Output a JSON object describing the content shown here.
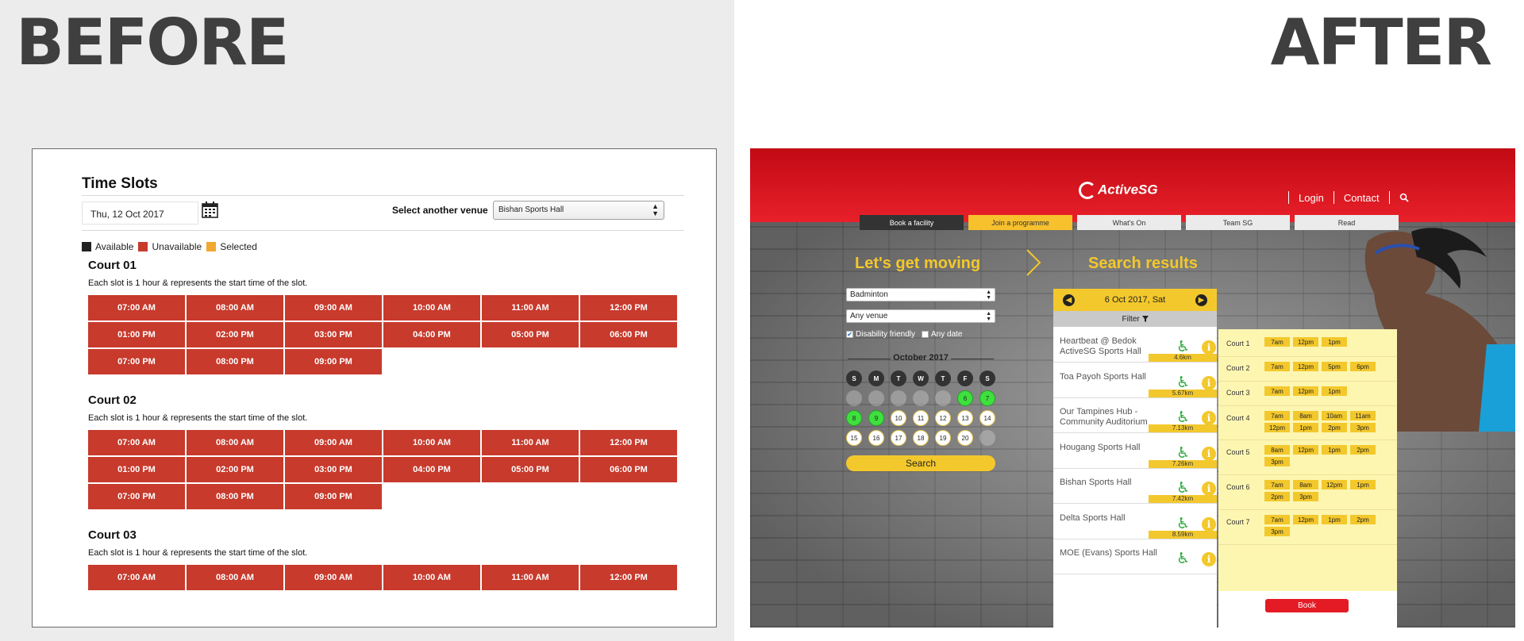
{
  "labels": {
    "before": "BEFORE",
    "after": "AFTER"
  },
  "before": {
    "title": "Time Slots",
    "date_value": "Thu, 12 Oct 2017",
    "venue_label": "Select another venue",
    "venue_value": "Bishan Sports Hall",
    "legend": [
      {
        "label": "Available",
        "color": "#222222"
      },
      {
        "label": "Unavailable",
        "color": "#c73a2c"
      },
      {
        "label": "Selected",
        "color": "#f0a830"
      }
    ],
    "courts": [
      {
        "name": "Court 01",
        "desc": "Each slot is 1 hour & represents the start time of the slot.",
        "slots": [
          "07:00 AM",
          "08:00 AM",
          "09:00 AM",
          "10:00 AM",
          "11:00 AM",
          "12:00 PM",
          "01:00 PM",
          "02:00 PM",
          "03:00 PM",
          "04:00 PM",
          "05:00 PM",
          "06:00 PM",
          "07:00 PM",
          "08:00 PM",
          "09:00 PM"
        ]
      },
      {
        "name": "Court 02",
        "desc": "Each slot is 1 hour & represents the start time of the slot.",
        "slots": [
          "07:00 AM",
          "08:00 AM",
          "09:00 AM",
          "10:00 AM",
          "11:00 AM",
          "12:00 PM",
          "01:00 PM",
          "02:00 PM",
          "03:00 PM",
          "04:00 PM",
          "05:00 PM",
          "06:00 PM",
          "07:00 PM",
          "08:00 PM",
          "09:00 PM"
        ]
      },
      {
        "name": "Court 03",
        "desc": "Each slot is 1 hour & represents the start time of the slot.",
        "slots": [
          "07:00 AM",
          "08:00 AM",
          "09:00 AM",
          "10:00 AM",
          "11:00 AM",
          "12:00 PM"
        ]
      }
    ]
  },
  "after": {
    "logo": "ActiveSG",
    "topnav": [
      "Login",
      "Contact"
    ],
    "tabs": [
      "Book a facility",
      "Join a programme",
      "What's On",
      "Team SG",
      "Read"
    ],
    "hero_left": "Let's get moving",
    "hero_right": "Search results",
    "sport_value": "Badminton",
    "venue_value": "Any venue",
    "check_disability": "Disability friendly",
    "check_anydate": "Any date",
    "month": "October 2017",
    "weekdays": [
      "S",
      "M",
      "T",
      "W",
      "T",
      "F",
      "S"
    ],
    "days": [
      {
        "d": "",
        "s": "past"
      },
      {
        "d": "",
        "s": "past"
      },
      {
        "d": "",
        "s": "past"
      },
      {
        "d": "",
        "s": "past"
      },
      {
        "d": "",
        "s": "past"
      },
      {
        "d": "6",
        "s": "green"
      },
      {
        "d": "7",
        "s": "green"
      },
      {
        "d": "8",
        "s": "green"
      },
      {
        "d": "9",
        "s": "green"
      },
      {
        "d": "10",
        "s": "white"
      },
      {
        "d": "11",
        "s": "white"
      },
      {
        "d": "12",
        "s": "white"
      },
      {
        "d": "13",
        "s": "white"
      },
      {
        "d": "14",
        "s": "white"
      },
      {
        "d": "15",
        "s": "white"
      },
      {
        "d": "16",
        "s": "white"
      },
      {
        "d": "17",
        "s": "white"
      },
      {
        "d": "18",
        "s": "white"
      },
      {
        "d": "19",
        "s": "white"
      },
      {
        "d": "20",
        "s": "white"
      },
      {
        "d": "",
        "s": "past"
      }
    ],
    "search_label": "Search",
    "result_date": "6 Oct 2017, Sat",
    "filter_label": "Filter",
    "venues": [
      {
        "name": "Heartbeat @ Bedok ActiveSG Sports Hall",
        "dist": "4.6km"
      },
      {
        "name": "Toa Payoh Sports Hall",
        "dist": "5.67km"
      },
      {
        "name": "Our Tampines Hub - Community Auditorium",
        "dist": "7.13km"
      },
      {
        "name": "Hougang Sports Hall",
        "dist": "7.26km"
      },
      {
        "name": "Bishan Sports Hall",
        "dist": "7.42km"
      },
      {
        "name": "Delta Sports Hall",
        "dist": "8.59km"
      },
      {
        "name": "MOE (Evans) Sports Hall",
        "dist": ""
      }
    ],
    "courts": [
      {
        "name": "Court 1",
        "times": [
          "7am",
          "12pm",
          "1pm"
        ]
      },
      {
        "name": "Court 2",
        "times": [
          "7am",
          "12pm",
          "5pm",
          "6pm"
        ]
      },
      {
        "name": "Court 3",
        "times": [
          "7am",
          "12pm",
          "1pm"
        ]
      },
      {
        "name": "Court 4",
        "times": [
          "7am",
          "8am",
          "10am",
          "11am",
          "12pm",
          "1pm",
          "2pm",
          "3pm"
        ]
      },
      {
        "name": "Court 5",
        "times": [
          "8am",
          "12pm",
          "1pm",
          "2pm",
          "3pm"
        ]
      },
      {
        "name": "Court 6",
        "times": [
          "7am",
          "8am",
          "12pm",
          "1pm",
          "2pm",
          "3pm"
        ]
      },
      {
        "name": "Court 7",
        "times": [
          "7am",
          "12pm",
          "1pm",
          "2pm",
          "3pm"
        ]
      }
    ],
    "book_label": "Book",
    "colors": {
      "red": "#e41b25",
      "yellow": "#f3c82c",
      "green": "#3ee03e"
    }
  }
}
